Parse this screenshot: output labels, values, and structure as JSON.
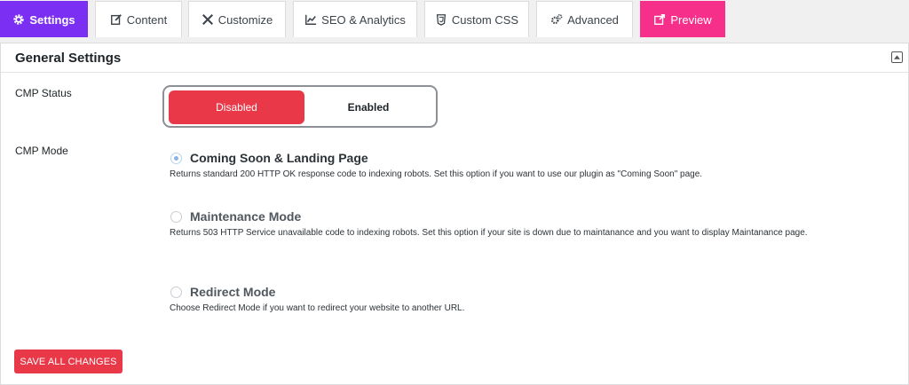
{
  "tabs": [
    {
      "label": "Settings",
      "icon": "gear-icon"
    },
    {
      "label": "Content",
      "icon": "edit-icon"
    },
    {
      "label": "Customize",
      "icon": "tools-icon"
    },
    {
      "label": "SEO & Analytics",
      "icon": "chart-icon"
    },
    {
      "label": "Custom CSS",
      "icon": "css3-icon"
    },
    {
      "label": "Advanced",
      "icon": "gears-icon"
    },
    {
      "label": "Preview",
      "icon": "external-link-icon"
    }
  ],
  "panel": {
    "title": "General Settings",
    "collapse_icon": "collapse-arrow-icon"
  },
  "cmp_status": {
    "label": "CMP Status",
    "options": [
      "Disabled",
      "Enabled"
    ],
    "selected": "Disabled"
  },
  "cmp_mode": {
    "label": "CMP Mode",
    "selected": "Coming Soon & Landing Page",
    "options": [
      {
        "title": "Coming Soon & Landing Page",
        "desc": "Returns standard 200 HTTP OK response code to indexing robots. Set this option if you want to use our plugin as \"Coming Soon\" page."
      },
      {
        "title": "Maintenance Mode",
        "desc": "Returns 503 HTTP Service unavailable code to indexing robots. Set this option if your site is down due to maintanance and you want to display Maintanance page."
      },
      {
        "title": "Redirect Mode",
        "desc": "Choose Redirect Mode if you want to redirect your website to another URL."
      }
    ]
  },
  "save_button": "SAVE ALL CHANGES",
  "colors": {
    "active_tab": "#7b2ff2",
    "preview_tab": "#f52f8a",
    "danger": "#e93848"
  }
}
